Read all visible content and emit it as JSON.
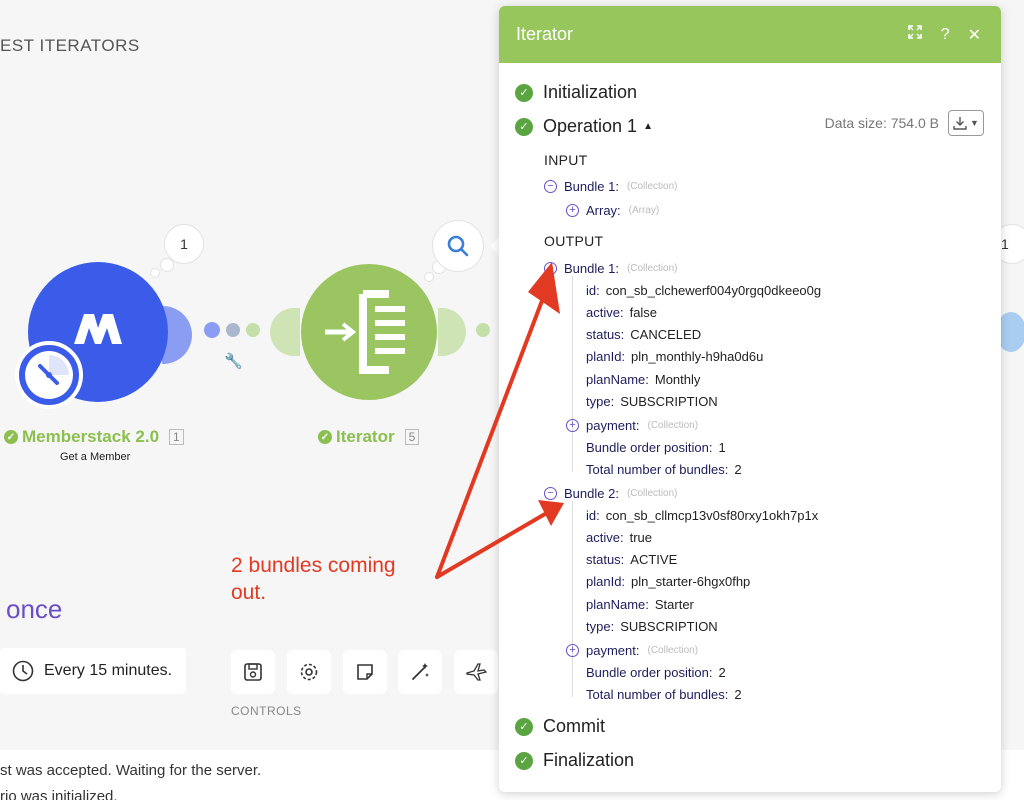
{
  "scenario": {
    "title_fragment": "EST ITERATORS",
    "run_once_fragment": "once"
  },
  "modules": {
    "memberstack": {
      "name": "Memberstack 2.0",
      "id": "1",
      "action": "Get a Member",
      "bubble_count": "1"
    },
    "iterator": {
      "name": "Iterator",
      "id": "5"
    },
    "right_bubble_count": "1"
  },
  "schedule": {
    "label": "Every 15 minutes."
  },
  "controls": {
    "label": "CONTROLS"
  },
  "log": {
    "line1": "st was accepted. Waiting for the server.",
    "line2": "rio was initialized."
  },
  "annotation": {
    "line1": "2 bundles coming",
    "line2": "out."
  },
  "colors": {
    "accent_green": "#97c65d",
    "memberstack_blue": "#3b5ce8",
    "annotation_red": "#e23a22",
    "run_once_purple": "#6a4fc7"
  },
  "icons": [
    "clock-icon",
    "save-icon",
    "gear-icon",
    "note-icon",
    "magic-wand-icon",
    "airplane-icon",
    "wrench-icon",
    "search-icon",
    "expand-icon",
    "help-icon",
    "close-icon",
    "download-icon"
  ],
  "panel": {
    "title": "Iterator",
    "help": "?",
    "close": "✕",
    "steps": {
      "init": "Initialization",
      "op": "Operation 1",
      "commit": "Commit",
      "final": "Finalization"
    },
    "data_size": "Data size: 754.0 B",
    "input": {
      "label": "INPUT",
      "bundle": "Bundle 1:",
      "bundle_type": "(Collection)",
      "array": "Array:",
      "array_type": "(Array)"
    },
    "output": {
      "label": "OUTPUT",
      "bundles": [
        {
          "title": "Bundle 1:",
          "type": "(Collection)",
          "id_key": "id:",
          "id": "con_sb_clchewerf004y0rgq0dkeeo0g",
          "active_key": "active:",
          "active": "false",
          "status_key": "status:",
          "status": "CANCELED",
          "planId_key": "planId:",
          "planId": "pln_monthly-h9ha0d6u",
          "planName_key": "planName:",
          "planName": "Monthly",
          "ptype_key": "type:",
          "ptype": "SUBSCRIPTION",
          "payment_key": "payment:",
          "payment_type": "(Collection)",
          "order_key": "Bundle order position:",
          "order": "1",
          "total_key": "Total number of bundles:",
          "total": "2"
        },
        {
          "title": "Bundle 2:",
          "type": "(Collection)",
          "id_key": "id:",
          "id": "con_sb_cllmcp13v0sf80rxy1okh7p1x",
          "active_key": "active:",
          "active": "true",
          "status_key": "status:",
          "status": "ACTIVE",
          "planId_key": "planId:",
          "planId": "pln_starter-6hgx0fhp",
          "planName_key": "planName:",
          "planName": "Starter",
          "ptype_key": "type:",
          "ptype": "SUBSCRIPTION",
          "payment_key": "payment:",
          "payment_type": "(Collection)",
          "order_key": "Bundle order position:",
          "order": "2",
          "total_key": "Total number of bundles:",
          "total": "2"
        }
      ]
    }
  }
}
